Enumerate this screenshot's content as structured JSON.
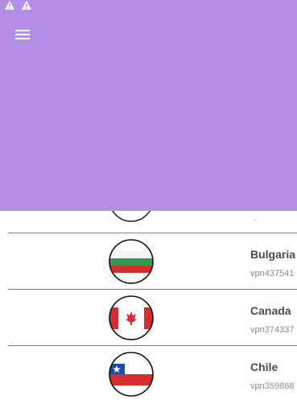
{
  "status_bar": {
    "icons": [
      "warning-icon",
      "warning-icon"
    ]
  },
  "header": {
    "menu_icon": "hamburger-menu-icon",
    "color": "#b58fe5"
  },
  "servers": [
    {
      "country": "Bulgaria",
      "host": "vpn437541",
      "flag": "bulgaria-flag-icon"
    },
    {
      "country": "Canada",
      "host": "vpn374337",
      "flag": "canada-flag-icon"
    },
    {
      "country": "Chile",
      "host": "vpn359868",
      "flag": "chile-flag-icon"
    }
  ]
}
